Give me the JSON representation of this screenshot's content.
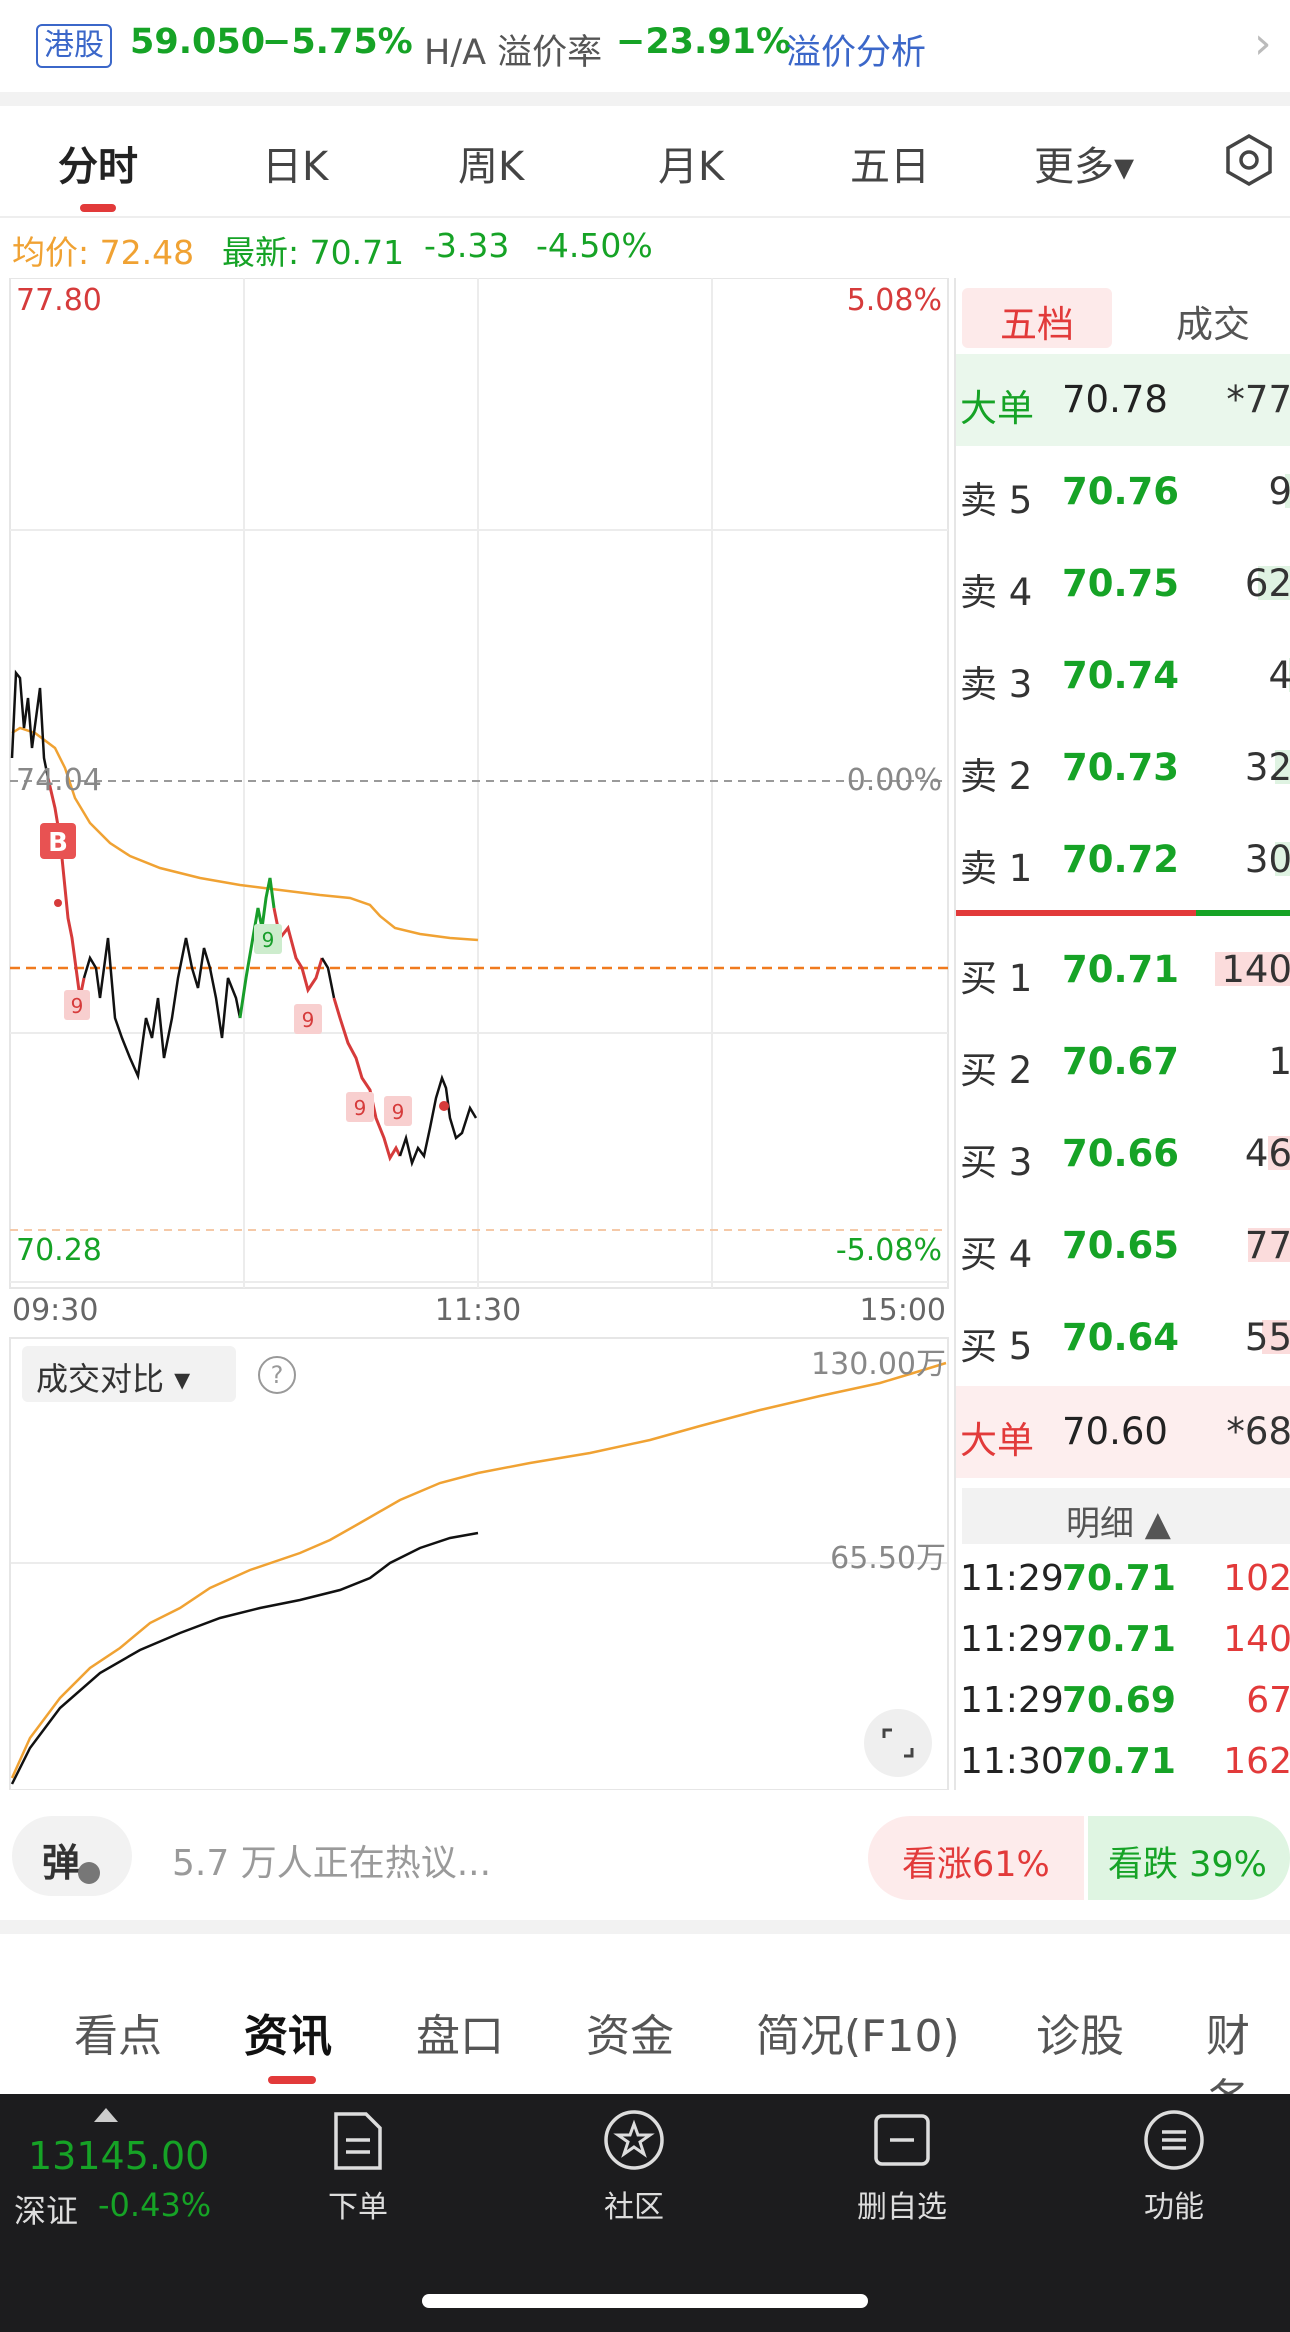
{
  "hk_bar": {
    "tag": "港股",
    "price": "59.050",
    "change": "−5.75%",
    "ha_label": "H/A 溢价率",
    "ha_value": "−23.91%",
    "link": "溢价分析",
    "chevron": "›"
  },
  "period_tabs": [
    "分时",
    "日K",
    "周K",
    "月K",
    "五日",
    "更多▾"
  ],
  "info": {
    "avg": "均价: 72.48",
    "last": "最新: 70.71",
    "change": "-3.33",
    "pct": "-4.50%"
  },
  "chart": {
    "y_high": "77.80",
    "y_mid": "74.04",
    "y_low": "70.28",
    "pct_high": "5.08%",
    "pct_mid": "0.00%",
    "pct_low": "-5.08%",
    "time_start": "09:30",
    "time_mid": "11:30",
    "time_end": "15:00",
    "marker_b": "B",
    "marker_9": "9"
  },
  "volume": {
    "selector": "成交对比 ▾",
    "help": "?",
    "y_high": "130.00万",
    "y_mid": "65.50万"
  },
  "book": {
    "tabs": [
      "五档",
      "成交"
    ],
    "big_sell": {
      "label": "大单",
      "price": "70.78",
      "vol": "*77"
    },
    "asks": [
      {
        "label": "卖 5",
        "price": "70.76",
        "vol": "9",
        "bar": 0.02
      },
      {
        "label": "卖 4",
        "price": "70.75",
        "vol": "62",
        "bar": 0.1
      },
      {
        "label": "卖 3",
        "price": "70.74",
        "vol": "4",
        "bar": 0.01
      },
      {
        "label": "卖 2",
        "price": "70.73",
        "vol": "32",
        "bar": 0.05
      },
      {
        "label": "卖 1",
        "price": "70.72",
        "vol": "30",
        "bar": 0.05
      }
    ],
    "bids": [
      {
        "label": "买 1",
        "price": "70.71",
        "vol": "140",
        "bar": 0.23
      },
      {
        "label": "买 2",
        "price": "70.67",
        "vol": "1",
        "bar": 0.0
      },
      {
        "label": "买 3",
        "price": "70.66",
        "vol": "46",
        "bar": 0.07
      },
      {
        "label": "买 4",
        "price": "70.65",
        "vol": "77",
        "bar": 0.13
      },
      {
        "label": "买 5",
        "price": "70.64",
        "vol": "55",
        "bar": 0.09
      }
    ],
    "big_buy": {
      "label": "大单",
      "price": "70.60",
      "vol": "*68"
    },
    "detail_label": "明细 ▲",
    "trades": [
      {
        "time": "11:29",
        "price": "70.71",
        "vol": "102"
      },
      {
        "time": "11:29",
        "price": "70.71",
        "vol": "140"
      },
      {
        "time": "11:29",
        "price": "70.69",
        "vol": "67"
      },
      {
        "time": "11:30",
        "price": "70.71",
        "vol": "162"
      }
    ]
  },
  "comments": {
    "danmu": "弹",
    "placeholder": "5.7 万人正在热议...",
    "bull": "看涨61%",
    "bear": "看跌 39%"
  },
  "bottom_tabs": [
    "看点",
    "资讯",
    "盘口",
    "资金",
    "简况(F10)",
    "诊股",
    "财务"
  ],
  "dock": {
    "index_value": "13145.00",
    "index_name": "深证",
    "index_change": "-0.43%",
    "items": [
      {
        "label": "下单",
        "icon": "order-document-icon"
      },
      {
        "label": "社区",
        "icon": "community-star-icon"
      },
      {
        "label": "删自选",
        "icon": "remove-watchlist-icon"
      },
      {
        "label": "功能",
        "icon": "menu-icon"
      }
    ]
  },
  "colors": {
    "up": "#e23a3a",
    "down": "#16a326",
    "avg": "#f0a233",
    "link": "#3b67c9"
  }
}
